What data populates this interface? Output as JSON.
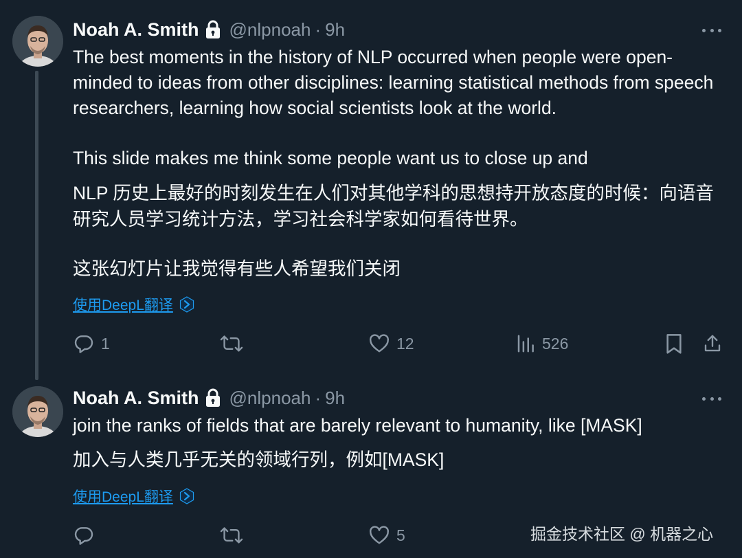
{
  "tweets": [
    {
      "author": "Noah A. Smith",
      "handle": "@nlpnoah",
      "separator": "·",
      "time": "9h",
      "text_en_p1": "The best moments in the history of NLP occurred when people were open-minded to ideas from other disciplines:  learning statistical methods from speech researchers, learning how social scientists look at the world.",
      "text_en_p2": "This slide makes me think some people want us to close up and",
      "text_zh_p1": "NLP 历史上最好的时刻发生在人们对其他学科的思想持开放态度的时候：向语音研究人员学习统计方法，学习社会科学家如何看待世界。",
      "text_zh_p2": "这张幻灯片让我觉得有些人希望我们关闭",
      "translate_label": "使用DeepL翻译",
      "replies": "1",
      "retweets": "",
      "likes": "12",
      "views": "526"
    },
    {
      "author": "Noah A. Smith",
      "handle": "@nlpnoah",
      "separator": "·",
      "time": "9h",
      "text_en_p1": "join the ranks of fields that are barely relevant to humanity, like [MASK]",
      "text_zh_p1": "加入与人类几乎无关的领域行列，例如[MASK]",
      "translate_label": "使用DeepL翻译",
      "replies": "",
      "retweets": "",
      "likes": "5"
    }
  ],
  "watermark": "掘金技术社区 @ 机器之心",
  "icons": {
    "lock": "lock-icon",
    "more": "more-icon",
    "reply": "reply-icon",
    "retweet": "retweet-icon",
    "like": "heart-icon",
    "views": "views-icon",
    "bookmark": "bookmark-icon",
    "share": "share-icon",
    "deepl": "deepl-icon"
  },
  "colors": {
    "background": "#15202b",
    "text": "#f7f9f9",
    "secondary": "#8b98a5",
    "link": "#1d9bf0",
    "thread_line": "#3d4a55"
  }
}
